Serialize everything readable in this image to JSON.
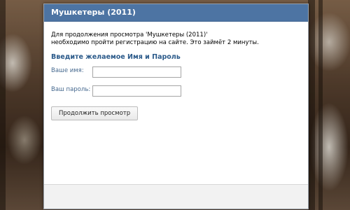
{
  "dialog": {
    "title": "Мушкетеры (2011)",
    "intro_line1": "Для продолжения просмотра 'Мушкетеры (2011)'",
    "intro_line2": "необходимо пройти регистрацию на сайте. Это займёт 2 минуты.",
    "section_title": "Введите желаемое Имя и Пароль",
    "name_label": "Ваше имя:",
    "name_value": "",
    "password_label": "Ваш пароль:",
    "password_value": "",
    "submit_label": "Продолжить просмотр"
  },
  "colors": {
    "header_bg": "#4d74a3",
    "section_title": "#2b5a8a",
    "label": "#45688e"
  }
}
